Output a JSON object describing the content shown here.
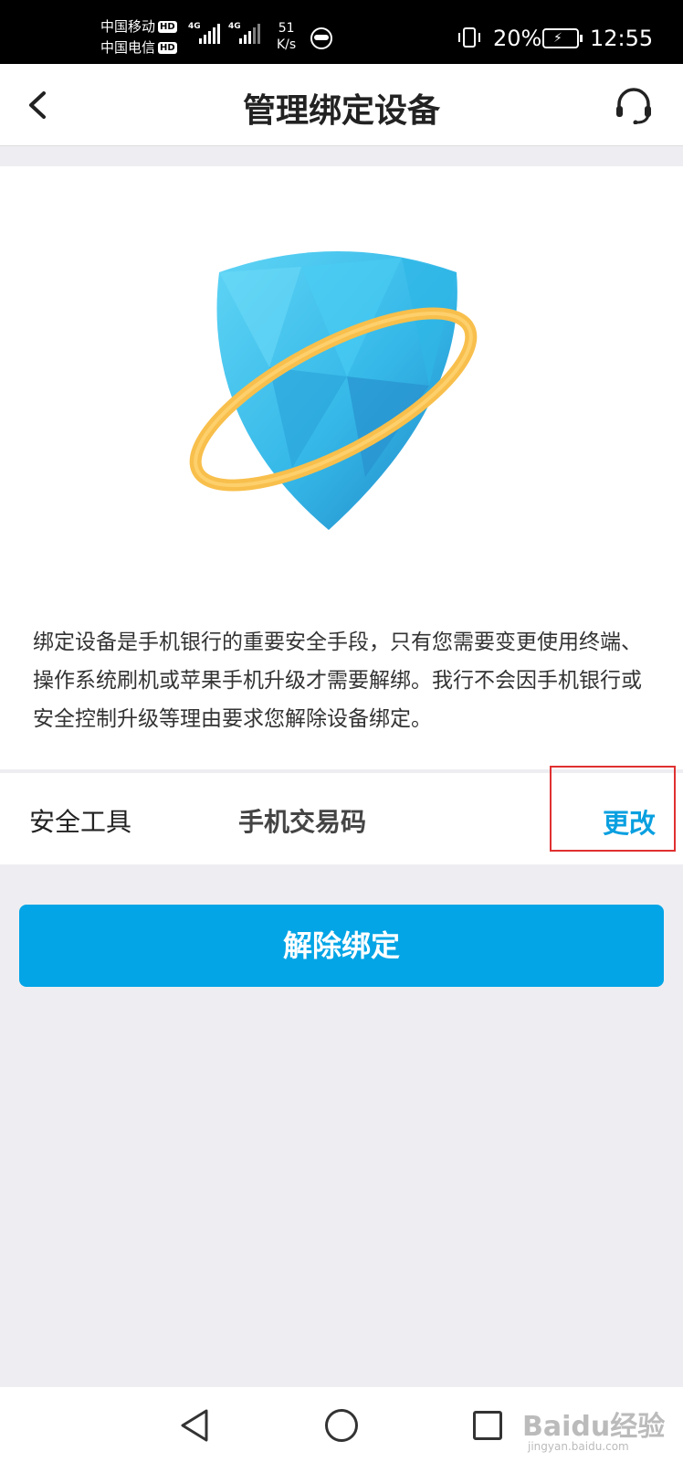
{
  "status_bar": {
    "carrier_1": "中国移动",
    "carrier_2": "中国电信",
    "hd_badge": "HD",
    "network_1": "4G",
    "network_2": "4G",
    "net_speed_value": "51",
    "net_speed_unit": "K/s",
    "battery_percent": "20%",
    "time": "12:55"
  },
  "navbar": {
    "title": "管理绑定设备",
    "back_icon": "chevron-left",
    "service_icon": "headset"
  },
  "illustration": {
    "name": "shield-with-orbit",
    "shield_color": "#3cc0ec",
    "ring_color": "#f8bf4c"
  },
  "description": "绑定设备是手机银行的重要安全手段，只有您需要变更使用终端、操作系统刷机或苹果手机升级才需要解绑。我行不会因手机银行或安全控制升级等理由要求您解除设备绑定。",
  "security_tool": {
    "label": "安全工具",
    "value": "手机交易码",
    "action": "更改"
  },
  "unbind_button": "解除绑定",
  "system_nav": {
    "back": "triangle-back",
    "home": "circle-home",
    "recent": "square-recent"
  },
  "watermark": {
    "main": "Baidu经验",
    "sub": "jingyan.baidu.com"
  },
  "colors": {
    "accent": "#03a5e6",
    "link": "#0aa0e0",
    "highlight_box": "#e03030",
    "background": "#eeeef2"
  }
}
